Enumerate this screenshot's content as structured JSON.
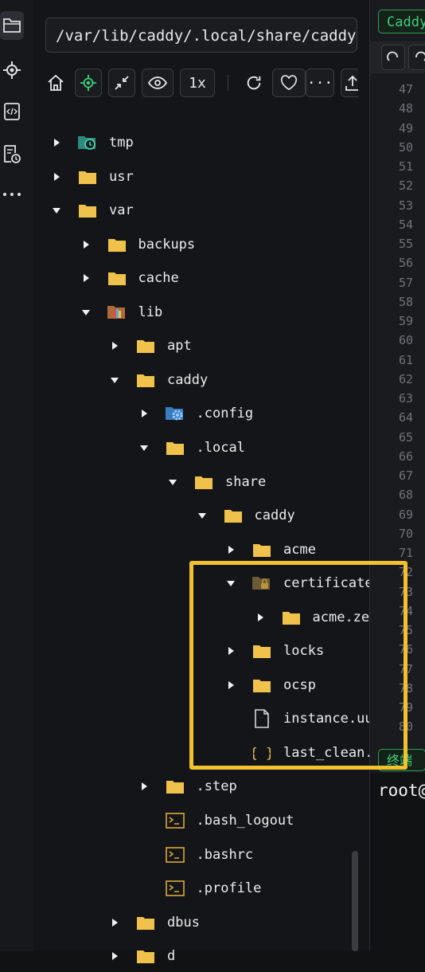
{
  "explorer": {
    "path_value": "/var/lib/caddy/.local/share/caddy/c",
    "toolbar": {
      "speed_label": "1x",
      "more_label": "···"
    },
    "items": [
      {
        "label": "tmp",
        "depth": 0,
        "expand": "closed",
        "icon": "clock-folder-icon"
      },
      {
        "label": "usr",
        "depth": 0,
        "expand": "closed",
        "icon": "folder-icon"
      },
      {
        "label": "var",
        "depth": 0,
        "expand": "open",
        "icon": "folder-icon"
      },
      {
        "label": "backups",
        "depth": 1,
        "expand": "closed",
        "icon": "folder-icon"
      },
      {
        "label": "cache",
        "depth": 1,
        "expand": "closed",
        "icon": "folder-icon"
      },
      {
        "label": "lib",
        "depth": 1,
        "expand": "open",
        "icon": "library-folder-icon"
      },
      {
        "label": "apt",
        "depth": 2,
        "expand": "closed",
        "icon": "folder-icon"
      },
      {
        "label": "caddy",
        "depth": 2,
        "expand": "open",
        "icon": "folder-icon"
      },
      {
        "label": ".config",
        "depth": 3,
        "expand": "closed",
        "icon": "config-folder-icon"
      },
      {
        "label": ".local",
        "depth": 3,
        "expand": "open",
        "icon": "folder-icon"
      },
      {
        "label": "share",
        "depth": 4,
        "expand": "open",
        "icon": "folder-icon"
      },
      {
        "label": "caddy",
        "depth": 5,
        "expand": "open",
        "icon": "folder-icon"
      },
      {
        "label": "acme",
        "depth": 6,
        "expand": "closed",
        "icon": "folder-icon"
      },
      {
        "label": "certificate",
        "depth": 6,
        "expand": "open",
        "icon": "lock-folder-icon"
      },
      {
        "label": "acme.ze",
        "depth": 7,
        "expand": "closed",
        "icon": "folder-icon"
      },
      {
        "label": "locks",
        "depth": 6,
        "expand": "closed",
        "icon": "folder-icon"
      },
      {
        "label": "ocsp",
        "depth": 6,
        "expand": "closed",
        "icon": "folder-icon"
      },
      {
        "label": "instance.uu",
        "depth": 6,
        "expand": "none",
        "icon": "file-icon"
      },
      {
        "label": "last_clean.",
        "depth": 6,
        "expand": "none",
        "icon": "json-file-icon"
      },
      {
        "label": ".step",
        "depth": 3,
        "expand": "closed",
        "icon": "folder-icon"
      },
      {
        "label": ".bash_logout",
        "depth": 3,
        "expand": "none",
        "icon": "terminal-file-icon"
      },
      {
        "label": ".bashrc",
        "depth": 3,
        "expand": "none",
        "icon": "terminal-file-icon"
      },
      {
        "label": ".profile",
        "depth": 3,
        "expand": "none",
        "icon": "terminal-file-icon"
      },
      {
        "label": "dbus",
        "depth": 2,
        "expand": "closed",
        "icon": "folder-icon"
      },
      {
        "label": "d",
        "depth": 2,
        "expand": "closed",
        "icon": "folder-icon"
      }
    ]
  },
  "editor": {
    "tab_title": "Caddy",
    "line_numbers": [
      "47",
      "48",
      "49",
      "50",
      "51",
      "52",
      "53",
      "54",
      "55",
      "56",
      "57",
      "58",
      "59",
      "60",
      "61",
      "62",
      "63",
      "64",
      "65",
      "66",
      "67",
      "68",
      "69",
      "70",
      "71",
      "72",
      "73",
      "74",
      "75",
      "76",
      "77",
      "78",
      "79",
      "80"
    ],
    "terminal_tab": "终端",
    "terminal_prompt": "root@"
  },
  "colors": {
    "accent_green": "#3ccf7a",
    "folder_yellow": "#f0c24b",
    "highlight": "#f2c12e"
  }
}
